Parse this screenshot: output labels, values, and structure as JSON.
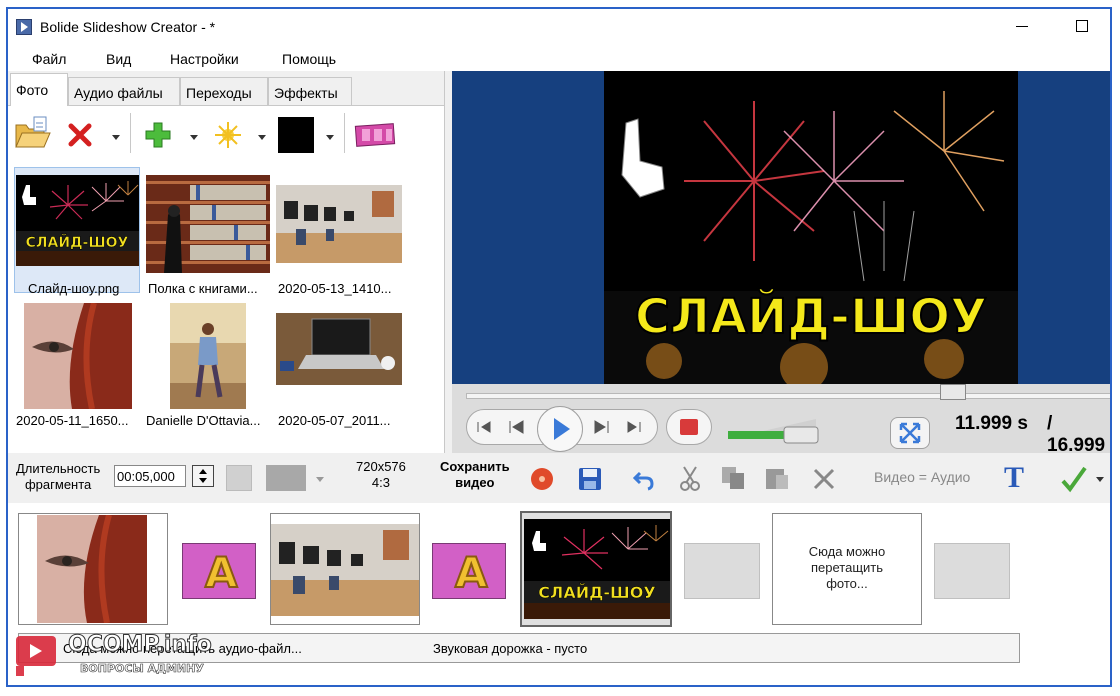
{
  "window": {
    "title": "Bolide Slideshow Creator - *"
  },
  "menu": [
    "Файл",
    "Вид",
    "Настройки",
    "Помощь"
  ],
  "tabs": [
    "Фото",
    "Аудио файлы",
    "Переходы",
    "Эффекты"
  ],
  "active_tab": "Фото",
  "photos": [
    {
      "caption": "Слайд-шоу.png",
      "selected": true
    },
    {
      "caption": "Полка с книгами..."
    },
    {
      "caption": "2020-05-13_1410..."
    },
    {
      "caption": "2020-05-11_1650..."
    },
    {
      "caption": "Danielle D'Ottavia..."
    },
    {
      "caption": "2020-05-07_2011..."
    }
  ],
  "preview": {
    "overlay_text": "СЛАЙД-ШОУ",
    "current_time": "11.999 s",
    "total_time": "/ 16.999",
    "position_fraction": 0.706,
    "volume_fraction": 0.7
  },
  "bottom_toolbar": {
    "duration_label_1": "Длительность",
    "duration_label_2": "фрагмента",
    "duration_value": "00:05,000",
    "resolution": "720x576",
    "aspect": "4:3",
    "save_label_1": "Сохранить",
    "save_label_2": "видео",
    "video_eq_audio": "Видео = Аудио"
  },
  "timeline": {
    "drop_hint_1": "Сюда можно",
    "drop_hint_2": "перетащить",
    "drop_hint_3": "фото...",
    "audio_drop_hint": "Сюда можно перетащить аудио-файл...",
    "audio_track": "Звуковая дорожка - пусто",
    "slide_overlay_text": "СЛАЙД-ШОУ"
  },
  "watermark": {
    "brand": "OCOMP.info",
    "tagline": "ВОПРОСЫ АДМИНУ"
  },
  "colors": {
    "accent_border": "#2a62c8",
    "video_bg": "#16407f",
    "transition": "#d260c6",
    "volume": "#3fae3f"
  }
}
